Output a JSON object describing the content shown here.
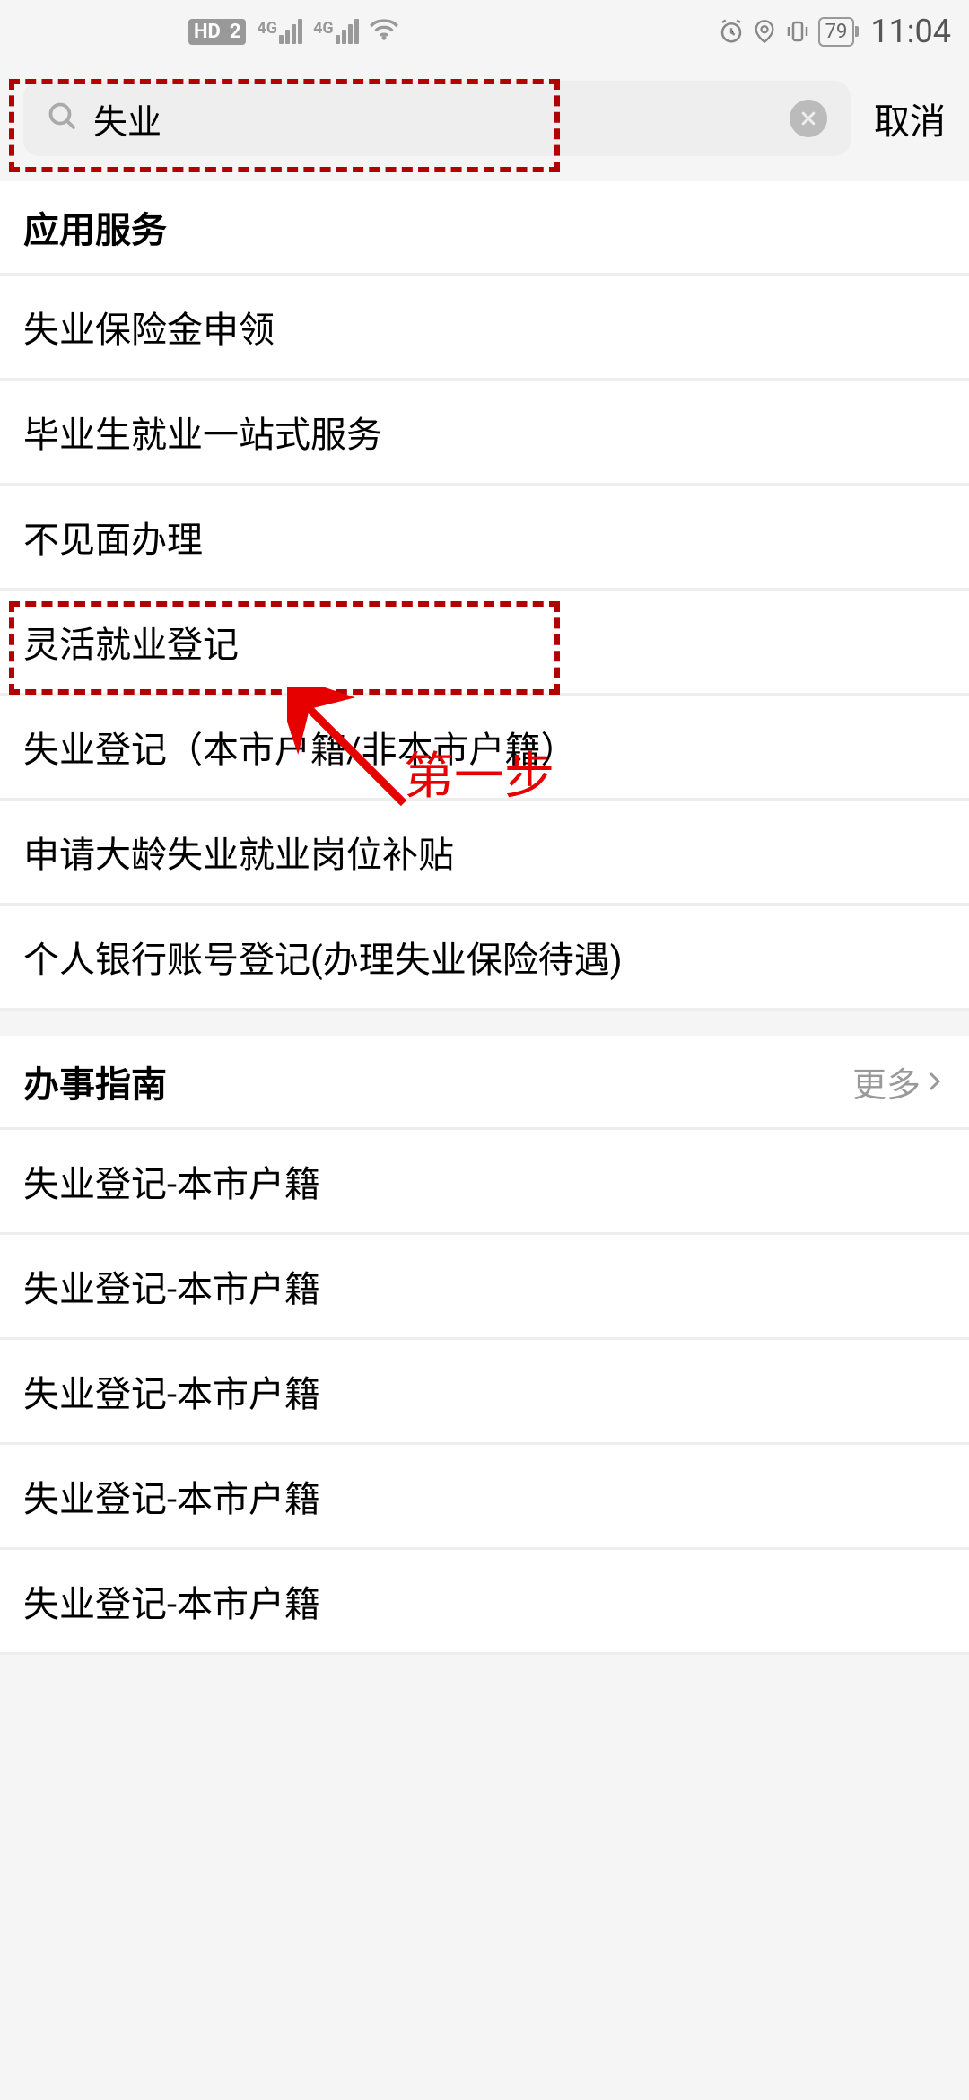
{
  "status_bar": {
    "hd_badge": "HD",
    "hd_num": "2",
    "signal_label": "4G",
    "battery": "79",
    "time": "11:04"
  },
  "search": {
    "value": "失业",
    "cancel": "取消"
  },
  "sections": {
    "services_header": "应用服务",
    "guide_header": "办事指南",
    "more_label": "更多"
  },
  "service_items": [
    "失业保险金申领",
    "毕业生就业一站式服务",
    "不见面办理",
    "灵活就业登记",
    "失业登记（本市户籍/非本市户籍）",
    "申请大龄失业就业岗位补贴",
    "个人银行账号登记(办理失业保险待遇)"
  ],
  "guide_items": [
    "失业登记-本市户籍",
    "失业登记-本市户籍",
    "失业登记-本市户籍",
    "失业登记-本市户籍",
    "失业登记-本市户籍"
  ],
  "annotation": {
    "step_label": "第一步"
  }
}
